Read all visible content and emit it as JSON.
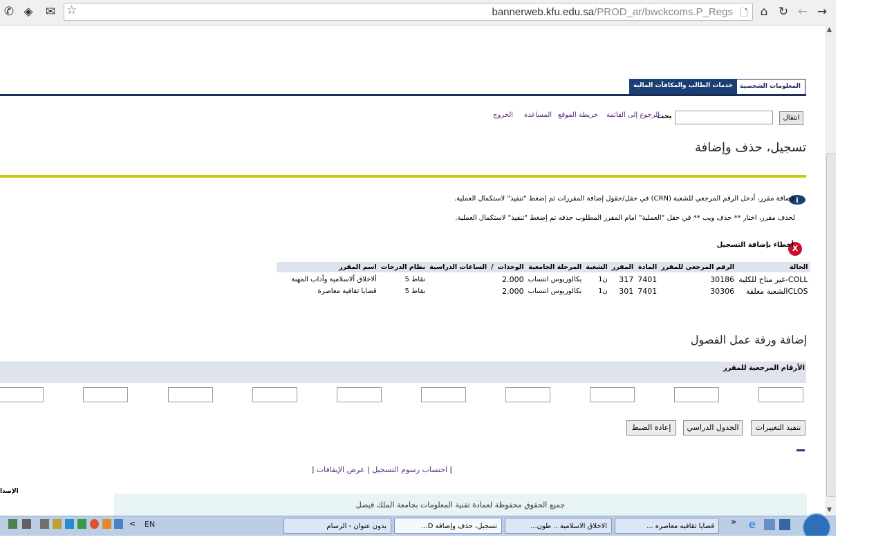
{
  "browser": {
    "url_host": "bannerweb.kfu.edu.sa",
    "url_path": "/PROD_ar/bwckcoms.P_Regs"
  },
  "page": {
    "tabs": [
      "المعلومات الشخصية",
      "خدمات الطالب والمكافآت المالية"
    ],
    "go_button": "انتقال",
    "search_label": "بحث",
    "nav_links": [
      "الرجوع إلى القائمة",
      "خريطة الموقع",
      "المساعدة",
      "الخروج"
    ],
    "title": "تسجيل، حذف وإضافة",
    "info_add": "لإضافة مقرر، أدخل الرقم المرجعي للشعبة (CRN) في حقل/حقول إضافة المقررات ثم إضغط \"تنفيذ\" لاستكمال العملية.",
    "info_drop": "لحذف مقرر، اختار ** حذف ويب ** في حقل \"العملية\" امام المقرر المطلوب حذفه ثم إضغط \"تنفيذ\" لاستكمال العملية.",
    "errors_label": "أخطاء بإضافة التسجيل",
    "table": {
      "headers": [
        "الحالة",
        "الرقم المرجعي للمقرر",
        "المادة",
        "المقرر",
        "الشعبة",
        "المرحلة الجامعية",
        "الوحدات",
        "/",
        "الساعات الدراسية",
        "نظام الدرجات",
        "اسم المقرر"
      ],
      "rows": [
        [
          "COLL-غير متاح للكلية",
          "30186",
          "7401",
          "317",
          "ن1",
          "بكالوريوس انتساب",
          "2.000",
          "",
          "",
          "نقاط 5",
          "ألاخلاق ألاسلامية وأداب المهنة"
        ],
        [
          "CLOSالشعبة مغلقة",
          "30306",
          "7401",
          "301",
          "ن1",
          "بكالوريوس انتساب",
          "2.000",
          "",
          "",
          "نقاط 5",
          "قضايا ثقافية معاصرة"
        ]
      ]
    },
    "worksheet_title": "إضافة ورقة عمل الفصول",
    "crn_label": "الأرقام المرجعية للمقرر",
    "buttons": [
      "تنفيذ التغييرات",
      "الجدول الدراسي",
      "إعادة الضبط"
    ],
    "bottom_links": [
      "[",
      "عرض الإيقافات",
      "|",
      "احتساب رسوم التسجيل",
      "]"
    ],
    "release_label": "الإصدا",
    "footer": "جميع الحقوق محفوظة لعمادة تقنية المعلومات بجامعة الملك فيصل"
  },
  "taskbar": {
    "buttons": [
      "قضايا ثقافيه معاصره ...",
      "الاخلاق الاسلامية .. طون...",
      "تسجيل، حذف وإضافة D...",
      "بدون عنوان - الرسام"
    ],
    "language": "EN",
    "chevron": "»"
  },
  "colors": {
    "nav": "#1c2d5a",
    "accent_line": "#cdc80a",
    "table_header": "#dfe3ee",
    "link": "#5a2a86"
  }
}
